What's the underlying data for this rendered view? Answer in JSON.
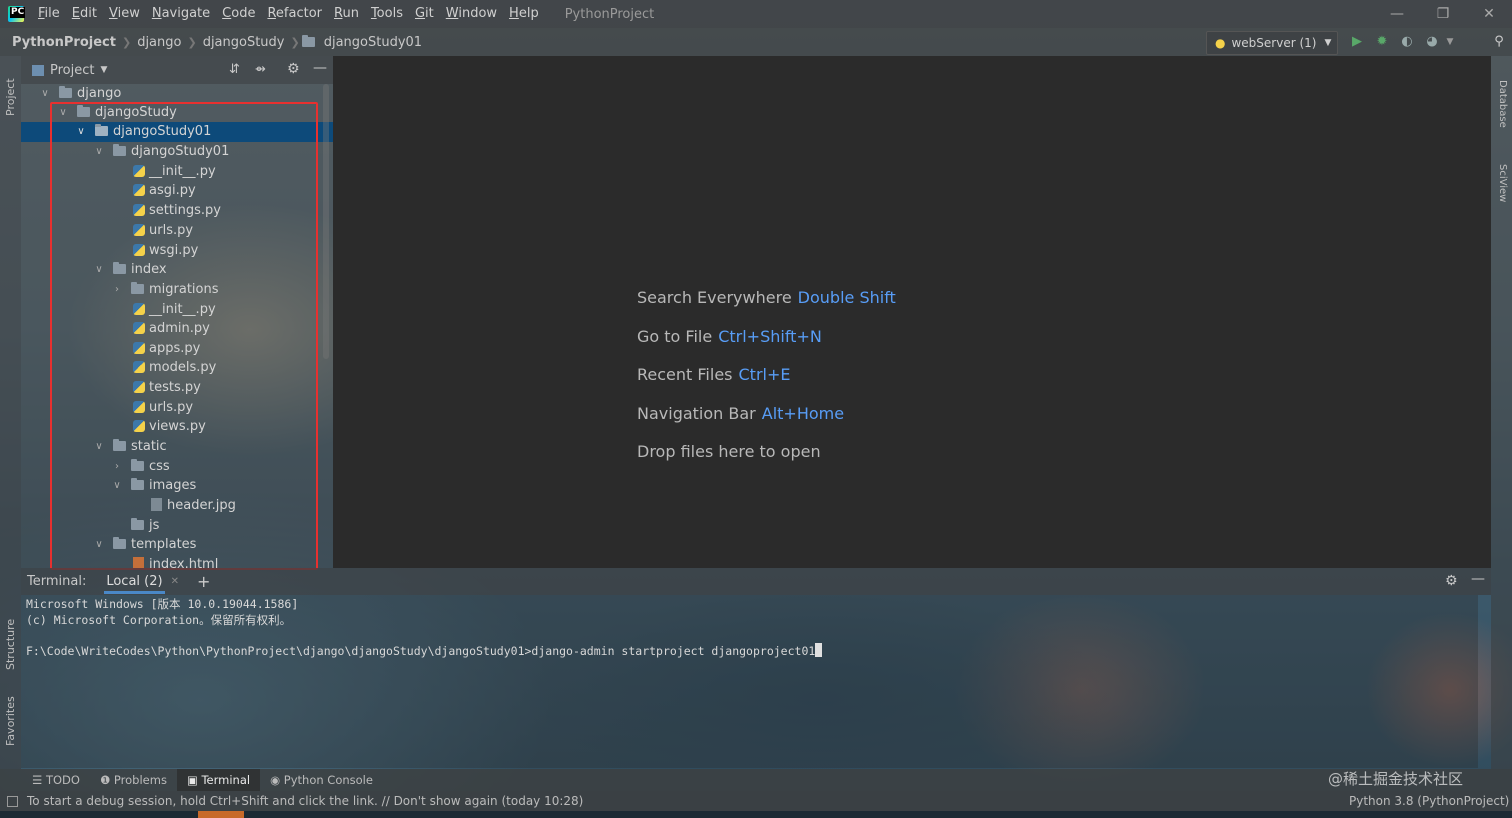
{
  "menu": {
    "items": [
      "File",
      "Edit",
      "View",
      "Navigate",
      "Code",
      "Refactor",
      "Run",
      "Tools",
      "Git",
      "Window",
      "Help"
    ],
    "project_title": "PythonProject"
  },
  "breadcrumb": [
    "PythonProject",
    "django",
    "djangoStudy",
    "djangoStudy01"
  ],
  "run_config": "webServer (1)",
  "side_tabs": {
    "project": "Project",
    "structure": "Structure",
    "favorites": "Favorites",
    "database": "Database",
    "sciview": "SciView"
  },
  "project_panel": {
    "title": "Project",
    "tree": [
      {
        "label": "django",
        "type": "folder",
        "open": true
      },
      {
        "label": "djangoStudy",
        "type": "folder",
        "open": true
      },
      {
        "label": "djangoStudy01",
        "type": "folder",
        "open": true,
        "selected": true
      },
      {
        "label": "djangoStudy01",
        "type": "folder",
        "open": true
      },
      {
        "label": "__init__.py",
        "type": "py"
      },
      {
        "label": "asgi.py",
        "type": "py"
      },
      {
        "label": "settings.py",
        "type": "py"
      },
      {
        "label": "urls.py",
        "type": "py"
      },
      {
        "label": "wsgi.py",
        "type": "py"
      },
      {
        "label": "index",
        "type": "folder",
        "open": true
      },
      {
        "label": "migrations",
        "type": "folder",
        "open": false
      },
      {
        "label": "__init__.py",
        "type": "py"
      },
      {
        "label": "admin.py",
        "type": "py"
      },
      {
        "label": "apps.py",
        "type": "py"
      },
      {
        "label": "models.py",
        "type": "py"
      },
      {
        "label": "tests.py",
        "type": "py"
      },
      {
        "label": "urls.py",
        "type": "py"
      },
      {
        "label": "views.py",
        "type": "py"
      },
      {
        "label": "static",
        "type": "folder",
        "open": true
      },
      {
        "label": "css",
        "type": "folder",
        "open": false
      },
      {
        "label": "images",
        "type": "folder",
        "open": true
      },
      {
        "label": "header.jpg",
        "type": "img"
      },
      {
        "label": "js",
        "type": "folder",
        "leaf": true
      },
      {
        "label": "templates",
        "type": "folder",
        "open": true
      },
      {
        "label": "index.html",
        "type": "html"
      }
    ]
  },
  "editor_hints": [
    {
      "label": "Search Everywhere",
      "shortcut": "Double Shift"
    },
    {
      "label": "Go to File",
      "shortcut": "Ctrl+Shift+N"
    },
    {
      "label": "Recent Files",
      "shortcut": "Ctrl+E"
    },
    {
      "label": "Navigation Bar",
      "shortcut": "Alt+Home"
    },
    {
      "label": "Drop files here to open",
      "shortcut": ""
    }
  ],
  "terminal": {
    "label": "Terminal:",
    "tab": "Local (2)",
    "lines": [
      "Microsoft Windows [版本 10.0.19044.1586]",
      "(c) Microsoft Corporation。保留所有权利。",
      "",
      "F:\\Code\\WriteCodes\\Python\\PythonProject\\django\\djangoStudy\\djangoStudy01>django-admin startproject djangoproject01"
    ]
  },
  "bottom_tabs": [
    "TODO",
    "Problems",
    "Terminal",
    "Python Console"
  ],
  "status": {
    "message": "To start a debug session, hold Ctrl+Shift and click the link. // Don't show again (today 10:28)",
    "interpreter": "Python 3.8 (PythonProject)",
    "watermark": "@稀土掘金技术社区"
  }
}
